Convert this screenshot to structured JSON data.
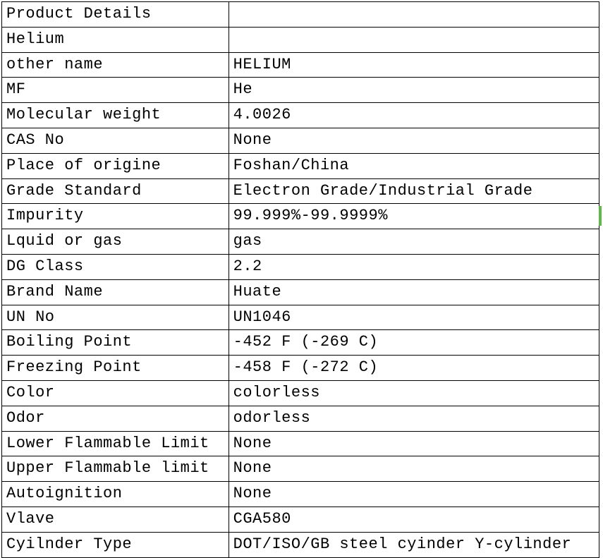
{
  "rows": [
    {
      "label": "Product Details",
      "value": ""
    },
    {
      "label": "Helium",
      "value": ""
    },
    {
      "label": "other name",
      "value": "HELIUM"
    },
    {
      "label": "MF",
      "value": "He"
    },
    {
      "label": "Molecular weight",
      "value": "4.0026"
    },
    {
      "label": "CAS No",
      "value": "None"
    },
    {
      "label": "Place of origine",
      "value": "Foshan/China"
    },
    {
      "label": "Grade Standard",
      "value": "Electron Grade/Industrial Grade"
    },
    {
      "label": "Impurity",
      "value": "99.999%-99.9999%"
    },
    {
      "label": "Lquid or gas",
      "value": "gas"
    },
    {
      "label": "DG Class",
      "value": "2.2"
    },
    {
      "label": "Brand Name",
      "value": "Huate"
    },
    {
      "label": "UN No",
      "value": "UN1046"
    },
    {
      "label": "Boiling Point",
      "value": "-452 F (-269 C)"
    },
    {
      "label": "Freezing Point",
      "value": " -458 F (-272 C)"
    },
    {
      "label": "Color",
      "value": " colorless"
    },
    {
      "label": "Odor",
      "value": "odorless"
    },
    {
      "label": "Lower Flammable Limit",
      "value": "None"
    },
    {
      "label": "Upper Flammable limit",
      "value": "None"
    },
    {
      "label": "Autoignition",
      "value": "None"
    },
    {
      "label": "Vlave",
      "value": "CGA580"
    },
    {
      "label": "Cyilnder Type",
      "value": "DOT/ISO/GB steel cyinder  Y-cylinder"
    }
  ]
}
